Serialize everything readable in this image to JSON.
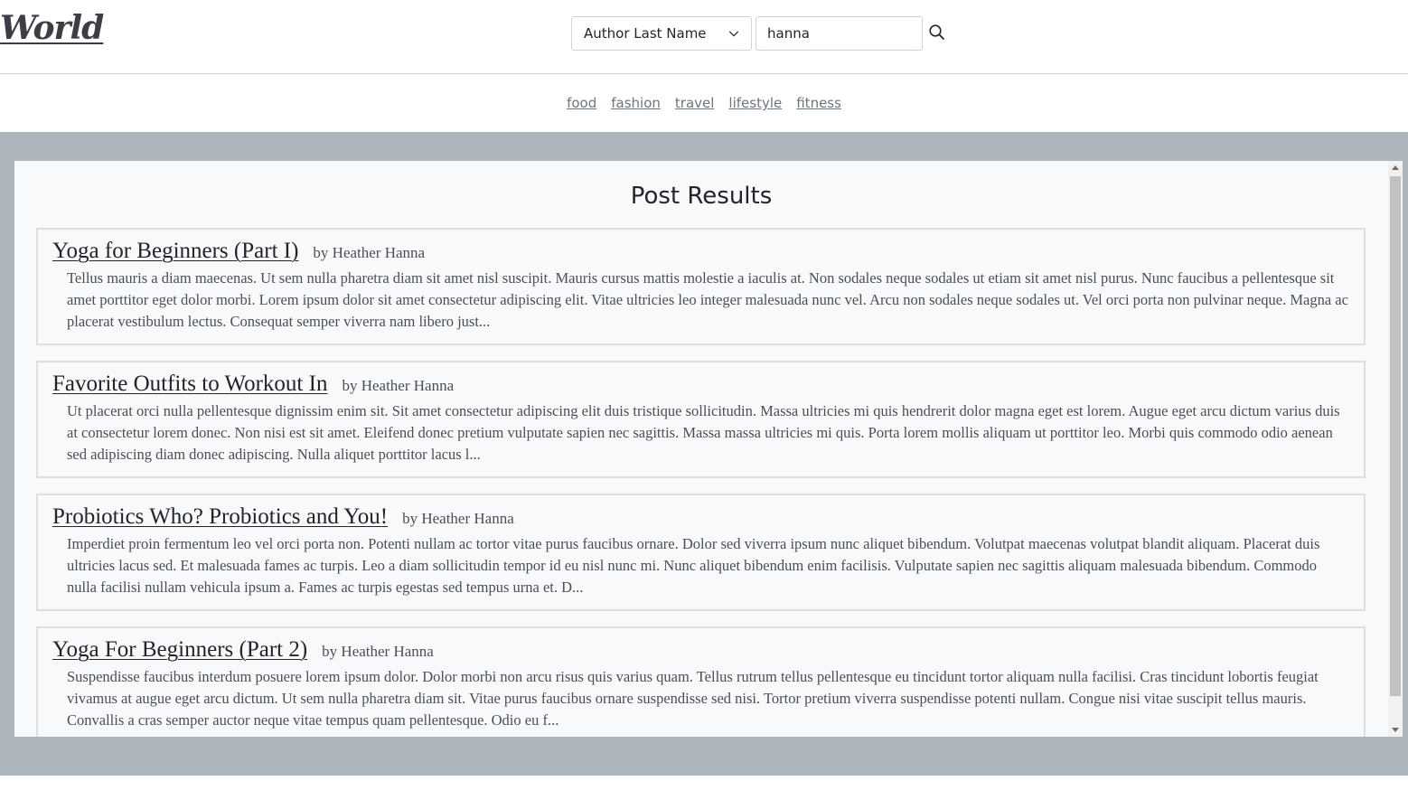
{
  "header": {
    "logo": "World",
    "search_field_selected": "Author Last Name",
    "search_query": "hanna"
  },
  "categories": [
    "food",
    "fashion",
    "travel",
    "lifestyle",
    "fitness"
  ],
  "results": {
    "title": "Post Results",
    "posts": [
      {
        "title": "Yoga for Beginners (Part I)",
        "author": "by Heather Hanna",
        "excerpt": "Tellus mauris a diam maecenas. Ut sem nulla pharetra diam sit amet nisl suscipit. Mauris cursus mattis molestie a iaculis at. Non sodales neque sodales ut etiam sit amet nisl purus. Nunc faucibus a pellentesque sit amet porttitor eget dolor morbi. Lorem ipsum dolor sit amet consectetur adipiscing elit. Vitae ultricies leo integer malesuada nunc vel. Arcu non sodales neque sodales ut. Vel orci porta non pulvinar neque. Magna ac placerat vestibulum lectus. Consequat semper viverra nam libero just..."
      },
      {
        "title": "Favorite Outfits to Workout In",
        "author": "by Heather Hanna",
        "excerpt": "Ut placerat orci nulla pellentesque dignissim enim sit. Sit amet consectetur adipiscing elit duis tristique sollicitudin. Massa ultricies mi quis hendrerit dolor magna eget est lorem. Augue eget arcu dictum varius duis at consectetur lorem donec. Non nisi est sit amet. Eleifend donec pretium vulputate sapien nec sagittis. Massa massa ultricies mi quis. Porta lorem mollis aliquam ut porttitor leo. Morbi quis commodo odio aenean sed adipiscing diam donec adipiscing. Nulla aliquet porttitor lacus l..."
      },
      {
        "title": "Probiotics Who? Probiotics and You!",
        "author": "by Heather Hanna",
        "excerpt": "Imperdiet proin fermentum leo vel orci porta non. Potenti nullam ac tortor vitae purus faucibus ornare. Dolor sed viverra ipsum nunc aliquet bibendum. Volutpat maecenas volutpat blandit aliquam. Placerat duis ultricies lacus sed. Et malesuada fames ac turpis. Leo a diam sollicitudin tempor id eu nisl nunc mi. Nunc aliquet bibendum enim facilisis. Vulputate sapien nec sagittis aliquam malesuada bibendum. Commodo nulla facilisi nullam vehicula ipsum a. Fames ac turpis egestas sed tempus urna et. D..."
      },
      {
        "title": "Yoga For Beginners (Part 2)",
        "author": "by Heather Hanna",
        "excerpt": "Suspendisse faucibus interdum posuere lorem ipsum dolor. Dolor morbi non arcu risus quis varius quam. Tellus rutrum tellus pellentesque eu tincidunt tortor aliquam nulla facilisi. Cras tincidunt lobortis feugiat vivamus at augue eget arcu dictum. Ut sem nulla pharetra diam sit. Vitae purus faucibus ornare suspendisse sed nisi. Tortor pretium viverra suspendisse potenti nullam. Congue nisi vitae suscipit tellus mauris. Convallis a cras semper auctor neque vitae tempus quam pellentesque. Odio eu f..."
      }
    ]
  },
  "colors": {
    "band_background": "#adb5bd",
    "panel_background": "#f8f9fa",
    "category_link": "#6c757d"
  }
}
